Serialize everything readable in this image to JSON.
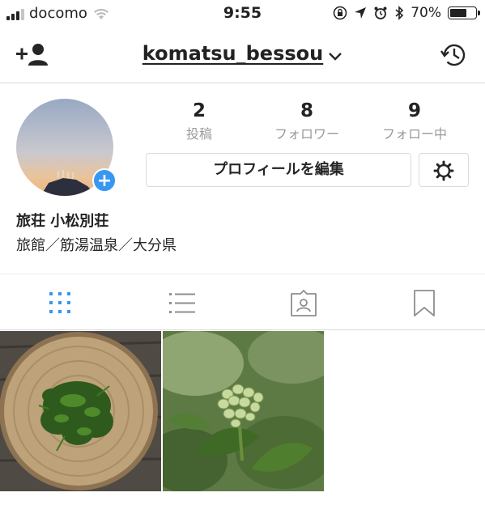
{
  "status_bar": {
    "carrier": "docomo",
    "time": "9:55",
    "battery_percent": "70%",
    "battery_level": 0.7
  },
  "nav": {
    "username": "komatsu_bessou",
    "left_icon": "add-user-icon",
    "right_icon": "history-icon"
  },
  "profile": {
    "display_name": "旅荘 小松別荘",
    "bio": "旅館／筋湯温泉／大分県",
    "stats": [
      {
        "value": "2",
        "label": "投稿"
      },
      {
        "value": "8",
        "label": "フォロワー"
      },
      {
        "value": "9",
        "label": "フォロー中"
      }
    ],
    "edit_profile_label": "プロフィールを編集",
    "avatar_badge": "+"
  },
  "tabs": [
    {
      "icon": "grid-icon",
      "active": true
    },
    {
      "icon": "list-icon",
      "active": false
    },
    {
      "icon": "tagged-icon",
      "active": false
    },
    {
      "icon": "saved-icon",
      "active": false
    }
  ],
  "posts": [
    {
      "content": "butterbur-shoots-in-basket"
    },
    {
      "content": "butterbur-sprout-plant"
    }
  ],
  "colors": {
    "accent": "#3897f0",
    "border": "#dbdbdb",
    "muted_text": "#999999"
  }
}
